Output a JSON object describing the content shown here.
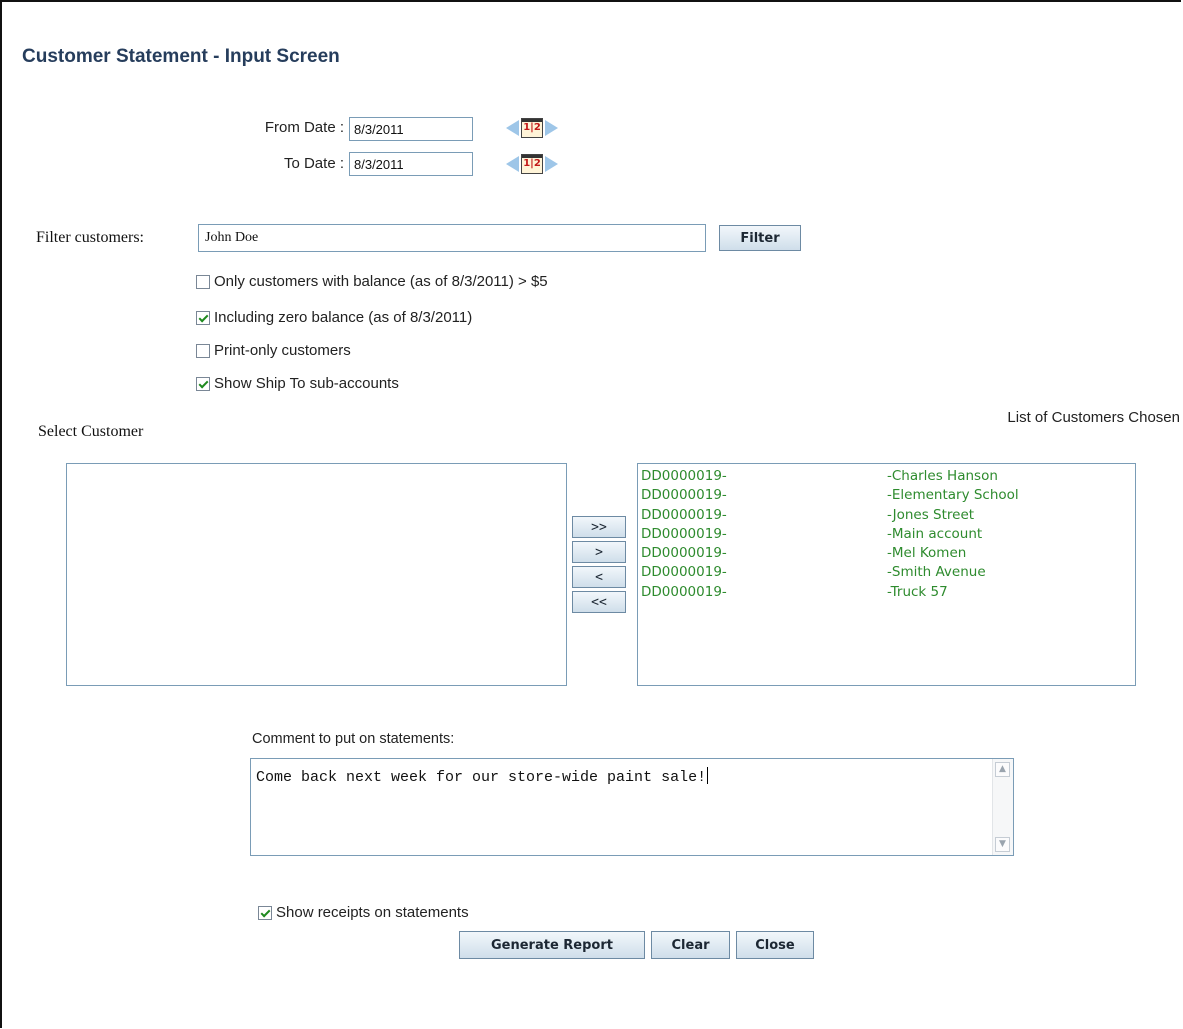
{
  "page": {
    "title": "Customer Statement -  Input Screen"
  },
  "dates": {
    "from_label": "From Date :",
    "from_value": "8/3/2011",
    "to_label": "To Date :",
    "to_value": "8/3/2011",
    "calendar_icon_text": "1|2"
  },
  "filter": {
    "label": "Filter customers:",
    "value": "John Doe",
    "button_label": "Filter"
  },
  "options": [
    {
      "label": "Only customers with balance (as of 8/3/2011) > $5",
      "checked": false
    },
    {
      "label": "Including zero balance (as of 8/3/2011)",
      "checked": true
    },
    {
      "label": "Print-only customers",
      "checked": false
    },
    {
      "label": "Show Ship To sub-accounts",
      "checked": true
    }
  ],
  "select_customer": {
    "label": "Select Customer",
    "items": []
  },
  "chosen": {
    "label": "List of Customers Chosen",
    "items": [
      {
        "code": "DD0000019-",
        "name": "-Charles Hanson"
      },
      {
        "code": "DD0000019-",
        "name": "-Elementary School"
      },
      {
        "code": "DD0000019-",
        "name": "-Jones Street"
      },
      {
        "code": "DD0000019-",
        "name": "-Main account"
      },
      {
        "code": "DD0000019-",
        "name": "-Mel Komen"
      },
      {
        "code": "DD0000019-",
        "name": "-Smith Avenue"
      },
      {
        "code": "DD0000019-",
        "name": "-Truck 57"
      }
    ]
  },
  "move_buttons": {
    "add_all": ">>",
    "add": ">",
    "remove": "<",
    "remove_all": "<<"
  },
  "comment": {
    "label": "Comment to put on statements:",
    "value": "Come back next week for our store-wide paint sale!"
  },
  "receipts": {
    "label": "Show receipts on statements",
    "checked": true
  },
  "actions": {
    "generate": "Generate Report",
    "clear": "Clear",
    "close": "Close"
  },
  "colors": {
    "title": "#263d5c",
    "list_text": "#2e8b2e",
    "border": "#7a9cb6",
    "arrow": "#9ec6e8"
  }
}
